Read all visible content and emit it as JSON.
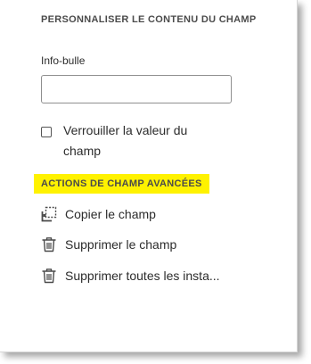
{
  "customize_section": {
    "title": "PERSONNALISER LE CONTENU DU CHAMP",
    "tooltip_label": "Info-bulle",
    "tooltip_value": "",
    "lock_value_label": "Verrouiller la valeur du champ",
    "lock_value_checked": false
  },
  "advanced_actions": {
    "title": "ACTIONS DE CHAMP AVANCÉES",
    "highlight_color": "#fff200",
    "items": [
      {
        "label": "Copier le champ",
        "icon": "copy-field-icon"
      },
      {
        "label": "Supprimer le champ",
        "icon": "trash-icon"
      },
      {
        "label": "Supprimer toutes les insta...",
        "icon": "trash-icon"
      }
    ]
  }
}
